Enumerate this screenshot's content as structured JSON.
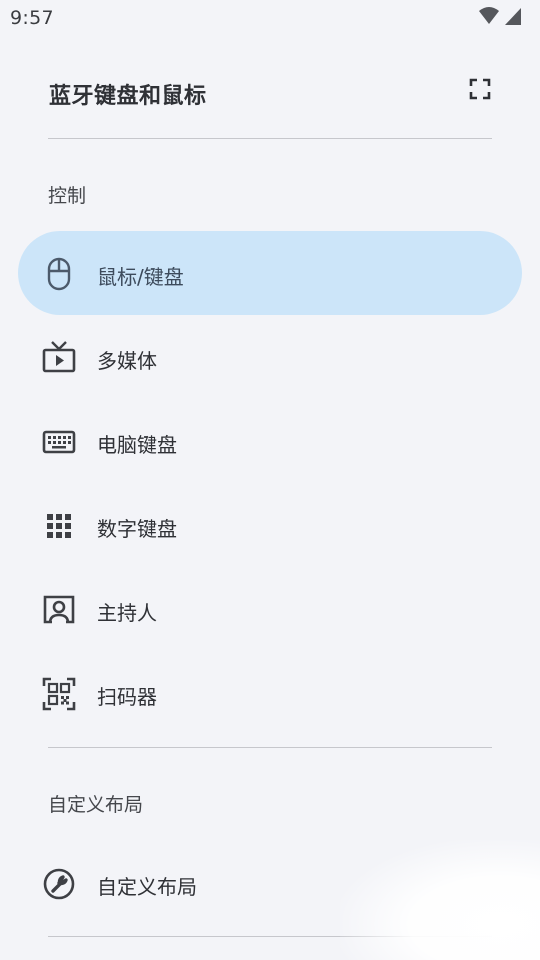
{
  "status_bar": {
    "time": "9:57",
    "icons": [
      "wifi-icon",
      "cellular-signal-icon"
    ]
  },
  "drawer": {
    "title": "蓝牙键盘和鼠标",
    "fullscreen_icon": "fullscreen-icon"
  },
  "sections": [
    {
      "label": "控制",
      "items": [
        {
          "label": "鼠标/键盘",
          "icon": "mouse-icon",
          "active": true
        },
        {
          "label": "多媒体",
          "icon": "tv-play-icon",
          "active": false
        },
        {
          "label": "电脑键盘",
          "icon": "keyboard-icon",
          "active": false
        },
        {
          "label": "数字键盘",
          "icon": "numpad-grid-icon",
          "active": false
        },
        {
          "label": "主持人",
          "icon": "presenter-icon",
          "active": false
        },
        {
          "label": "扫码器",
          "icon": "qr-scanner-icon",
          "active": false
        }
      ]
    },
    {
      "label": "自定义布局",
      "items": [
        {
          "label": "自定义布局",
          "icon": "wrench-icon",
          "active": false
        }
      ]
    }
  ],
  "colors": {
    "background": "#f3f4f8",
    "active_item": "#cce5f9",
    "divider": "#c6c7cc",
    "icon": "#3e4045",
    "text": "#2f3136"
  }
}
